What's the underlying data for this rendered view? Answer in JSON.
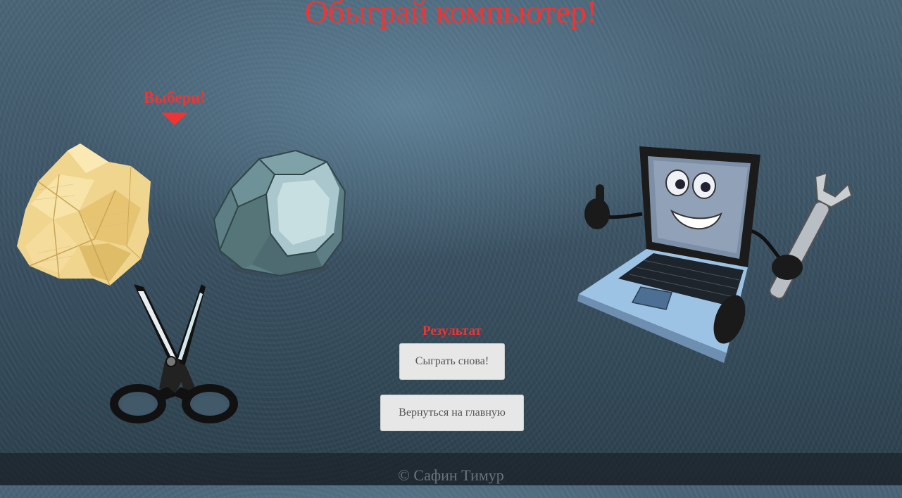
{
  "header": {
    "title": "Обыграй компьютер!"
  },
  "prompt": {
    "label": "Выбери!"
  },
  "choices": [
    {
      "key": "paper",
      "icon": "crumpled-paper-icon"
    },
    {
      "key": "rock",
      "icon": "rock-icon"
    },
    {
      "key": "scissors",
      "icon": "scissors-icon"
    }
  ],
  "opponent": {
    "icon": "laptop-mascot-icon"
  },
  "result": {
    "label": "Результат"
  },
  "buttons": {
    "play_again": "Сыграть снова!",
    "back_home": "Вернуться на главную"
  },
  "footer": {
    "copyright": "© Сафин Тимур"
  },
  "colors": {
    "accent": "#f03434",
    "background": "#3c5566",
    "button_bg": "#e7e7e7",
    "button_text": "#555555",
    "footer_text": "#6a747c"
  }
}
